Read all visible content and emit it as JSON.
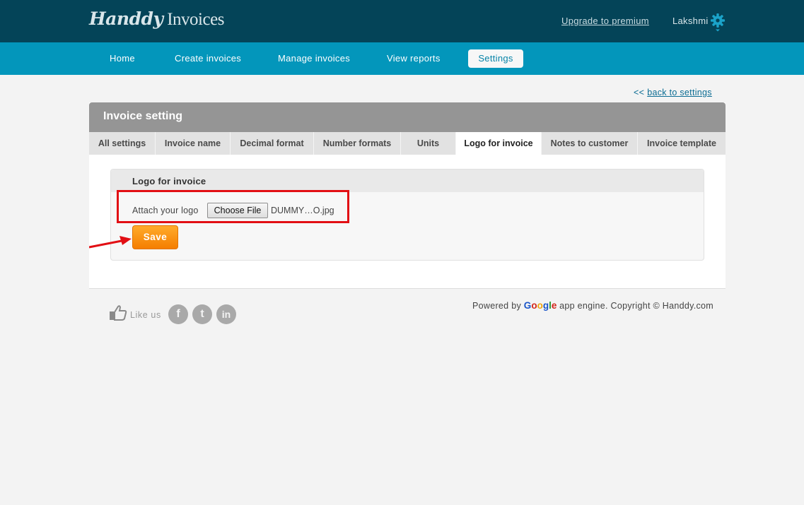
{
  "app": {
    "logo_script": "Handdy",
    "logo_plain": " Invoices",
    "upgrade_link": "Upgrade to premium",
    "user_name": "Lakshmi",
    "gear_icon": "gear-icon"
  },
  "nav": {
    "items": [
      "Home",
      "Create invoices",
      "Manage invoices",
      "View reports",
      "Settings"
    ],
    "active": "Settings"
  },
  "back_link": {
    "chevron": "<<",
    "label": "back to settings"
  },
  "panel": {
    "title": "Invoice setting",
    "tabs": [
      "All settings",
      "Invoice name",
      "Decimal format",
      "Number formats",
      "Units",
      "Logo for invoice",
      "Notes to customer",
      "Invoice template"
    ],
    "active_tab": "Logo for invoice"
  },
  "logo_section": {
    "title": "Logo for invoice",
    "attach_label": "Attach your logo",
    "choose_file_label": "Choose File",
    "file_name": "DUMMY…O.jpg",
    "save_label": "Save"
  },
  "annotations": {
    "highlight_color": "#e20f14",
    "arrow_color": "#e20f14"
  },
  "footer": {
    "like_label": "Like us",
    "social": [
      "f",
      "t",
      "in"
    ],
    "powered_prefix": "Powered by ",
    "google_letters": [
      "G",
      "o",
      "o",
      "g",
      "l",
      "e"
    ],
    "powered_suffix": " app engine. Copyright © Handdy.com"
  },
  "colors": {
    "topbar": "#044458",
    "navbar": "#0396bb",
    "save_button": "#f57e00",
    "panel_header": "#959595"
  }
}
